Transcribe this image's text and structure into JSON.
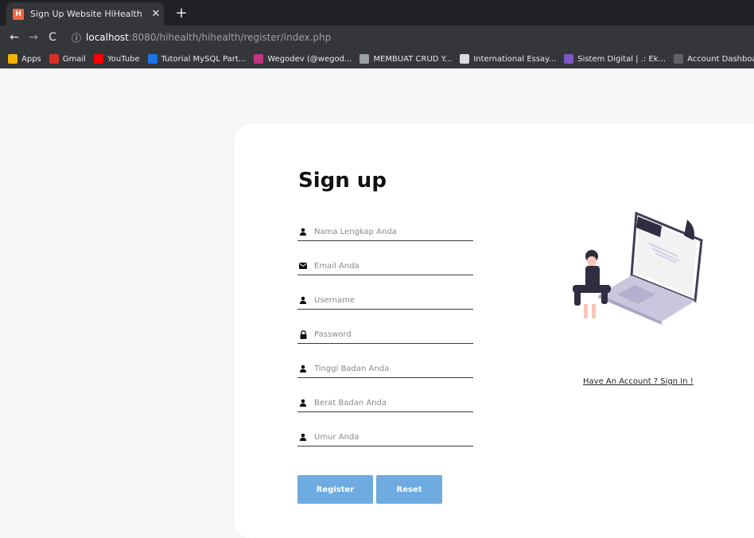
{
  "browser": {
    "tab_title": "Sign Up Website HiHealth",
    "tab_favicon": "H",
    "url_host": "localhost",
    "url_path": ":8080/hihealth/hihealth/register/index.php",
    "bookmarks": [
      {
        "label": "Apps",
        "color": "#f4b400"
      },
      {
        "label": "Gmail",
        "color": "#d93025"
      },
      {
        "label": "YouTube",
        "color": "#ff0000"
      },
      {
        "label": "Tutorial MySQL Part...",
        "color": "#1a73e8"
      },
      {
        "label": "Wegodev (@wegod...",
        "color": "#c13584"
      },
      {
        "label": "MEMBUAT CRUD Y...",
        "color": "#9aa0a6"
      },
      {
        "label": "International Essay...",
        "color": "#dadce0"
      },
      {
        "label": "Sistem Digital | .: Ek...",
        "color": "#7e57c2"
      },
      {
        "label": "Account Dashboard...",
        "color": "#5f6368"
      }
    ]
  },
  "form": {
    "title": "Sign up",
    "fields": [
      {
        "icon": "user-icon",
        "placeholder": "Nama Lengkap Anda"
      },
      {
        "icon": "envelope-icon",
        "placeholder": "Email Anda"
      },
      {
        "icon": "user-icon",
        "placeholder": "Username"
      },
      {
        "icon": "lock-icon",
        "placeholder": "Password"
      },
      {
        "icon": "user-icon",
        "placeholder": "Tinggi Badan Anda"
      },
      {
        "icon": "user-icon",
        "placeholder": "Berat Badan Anda"
      },
      {
        "icon": "user-icon",
        "placeholder": "Umur Anda"
      }
    ],
    "register_label": "Register",
    "reset_label": "Reset",
    "button_color": "#6eabe0"
  },
  "aside": {
    "signin_link": "Have An Account ? Sign In !"
  }
}
